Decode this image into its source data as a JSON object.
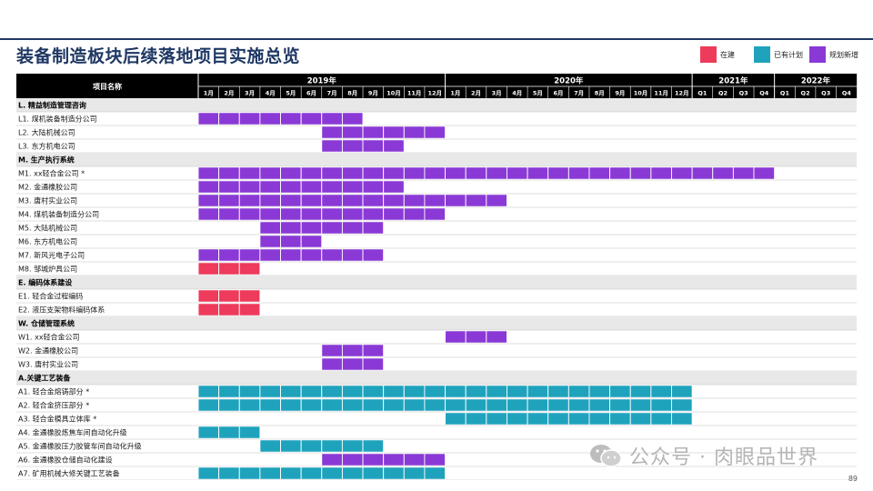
{
  "title": "装备制造板块后续落地项目实施总览",
  "legend": [
    {
      "label": "在建",
      "color": "#ee3a5b"
    },
    {
      "label": "已有计划",
      "color": "#1fa3bd"
    },
    {
      "label": "规划新增",
      "color": "#8a39d6"
    }
  ],
  "header": {
    "name_label": "项目名称",
    "years": [
      {
        "label": "2019年"
      },
      {
        "label": "2020年"
      },
      {
        "label": "2021年"
      },
      {
        "label": "2022年"
      }
    ],
    "periods": [
      "1月",
      "2月",
      "3月",
      "4月",
      "5月",
      "6月",
      "7月",
      "8月",
      "9月",
      "10月",
      "11月",
      "12月",
      "1月",
      "2月",
      "3月",
      "4月",
      "5月",
      "6月",
      "7月",
      "8月",
      "9月",
      "10月",
      "11月",
      "12月",
      "Q1",
      "Q2",
      "Q3",
      "Q4",
      "Q1",
      "Q2",
      "Q3",
      "Q4"
    ]
  },
  "rows": [
    {
      "label": "L. 精益制造管理咨询",
      "section": true
    },
    {
      "label": "L1. 煤机装备制造分公司",
      "bars": [
        {
          "start": 1,
          "end": 8,
          "status": 2
        }
      ]
    },
    {
      "label": "L2. 大陆机械公司",
      "bars": [
        {
          "start": 7,
          "end": 12,
          "status": 2
        }
      ]
    },
    {
      "label": "L3. 东方机电公司",
      "bars": [
        {
          "start": 7,
          "end": 10,
          "status": 2
        }
      ]
    },
    {
      "label": "M. 生产执行系统",
      "section": true
    },
    {
      "label": "M1. xx轻合金公司 *",
      "bars": [
        {
          "start": 1,
          "end": 28,
          "status": 2
        }
      ]
    },
    {
      "label": "M2. 金通橡胶公司",
      "bars": [
        {
          "start": 1,
          "end": 10,
          "status": 2
        }
      ]
    },
    {
      "label": "M3. 唐村实业公司",
      "bars": [
        {
          "start": 1,
          "end": 15,
          "status": 2
        }
      ]
    },
    {
      "label": "M4. 煤机装备制造分公司",
      "bars": [
        {
          "start": 1,
          "end": 12,
          "status": 2
        }
      ]
    },
    {
      "label": "M5. 大陆机械公司",
      "bars": [
        {
          "start": 4,
          "end": 9,
          "status": 2
        }
      ]
    },
    {
      "label": "M6. 东方机电公司",
      "bars": [
        {
          "start": 4,
          "end": 6,
          "status": 2
        }
      ]
    },
    {
      "label": "M7. 新风光电子公司",
      "bars": [
        {
          "start": 1,
          "end": 9,
          "status": 2
        }
      ]
    },
    {
      "label": "M8. 邹城炉具公司",
      "bars": [
        {
          "start": 1,
          "end": 3,
          "status": 0
        }
      ]
    },
    {
      "label": "E. 编码体系建设",
      "section": true
    },
    {
      "label": "E1. 轻合金过程编码",
      "bars": [
        {
          "start": 1,
          "end": 3,
          "status": 0
        }
      ]
    },
    {
      "label": "E2. 液压支架物料编码体系",
      "bars": [
        {
          "start": 1,
          "end": 3,
          "status": 0
        }
      ]
    },
    {
      "label": "W. 仓储管理系统",
      "section": true
    },
    {
      "label": "W1. xx轻合金公司",
      "bars": [
        {
          "start": 13,
          "end": 15,
          "status": 2
        }
      ]
    },
    {
      "label": "W2. 金通橡胶公司",
      "bars": [
        {
          "start": 7,
          "end": 9,
          "status": 2
        }
      ]
    },
    {
      "label": "W3. 唐村实业公司",
      "bars": [
        {
          "start": 7,
          "end": 9,
          "status": 2
        }
      ]
    },
    {
      "label": "A.关键工艺装备",
      "section": true
    },
    {
      "label": "A1. 轻合金熔铸部分 *",
      "bars": [
        {
          "start": 1,
          "end": 24,
          "status": 1
        }
      ]
    },
    {
      "label": "A2. 轻合金挤压部分 *",
      "bars": [
        {
          "start": 1,
          "end": 24,
          "status": 1
        }
      ]
    },
    {
      "label": "A3. 轻合金模具立体库 *",
      "bars": [
        {
          "start": 13,
          "end": 24,
          "status": 1
        }
      ]
    },
    {
      "label": "A4. 金通橡胶炼焦车间自动化升级",
      "bars": [
        {
          "start": 1,
          "end": 3,
          "status": 1
        }
      ]
    },
    {
      "label": "A5. 金通橡胶压力胶管车间自动化升级",
      "bars": [
        {
          "start": 4,
          "end": 9,
          "status": 1
        }
      ]
    },
    {
      "label": "A6. 金通橡胶仓储自动化建设",
      "bars": [
        {
          "start": 7,
          "end": 12,
          "status": 2
        }
      ]
    },
    {
      "label": "A7. 矿用机械大修关键工艺装备",
      "bars": [
        {
          "start": 1,
          "end": 12,
          "status": 1
        }
      ]
    }
  ],
  "page_number": "89",
  "watermark": "公众号 · 肉眼品世界"
}
